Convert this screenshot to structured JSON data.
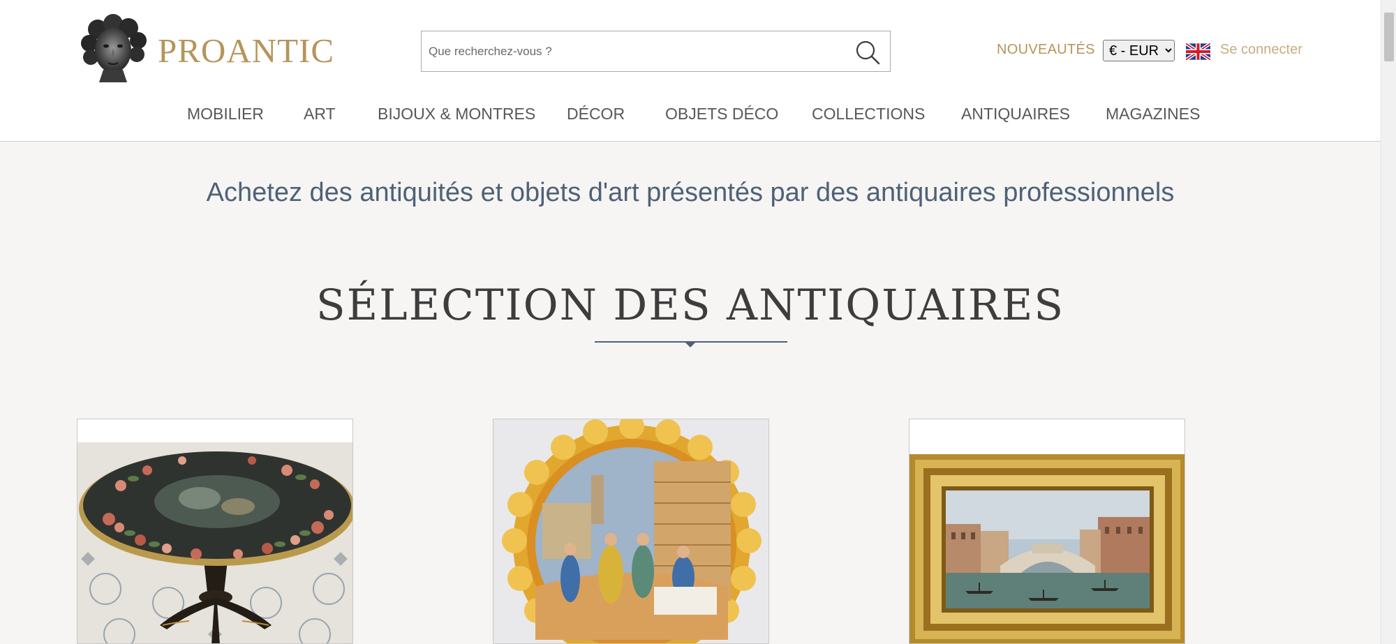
{
  "header": {
    "brand": "PROANTIC",
    "search_placeholder": "Que recherchez-vous ?",
    "new_label": "NOUVEAUTÉS",
    "currency_selected": "€ - EUR",
    "login_label": "Se connecter"
  },
  "nav": {
    "items": [
      "MOBILIER",
      "ART",
      "BIJOUX & MONTRES",
      "DÉCOR",
      "OBJETS DÉCO",
      "COLLECTIONS",
      "ANTIQUAIRES",
      "MAGAZINES"
    ]
  },
  "main": {
    "tagline": "Achetez des antiquités et objets d'art présentés par des antiquaires professionnels",
    "section_title": "SÉLECTION DES ANTIQUAIRES",
    "products": [
      {
        "image": "painted-tilt-top-table"
      },
      {
        "image": "majolica-plate"
      },
      {
        "image": "framed-venice-painting"
      }
    ]
  },
  "colors": {
    "brand_gold": "#b6945a",
    "login_gold": "#c7ad82",
    "nav_text": "#575757",
    "tagline_blue": "#4f6178",
    "title_dark": "#3d3d3d",
    "page_bg": "#f6f5f3"
  },
  "icons": {
    "logo": "classical-bust-logo",
    "search": "magnifier-icon",
    "flag": "uk-flag-icon"
  }
}
